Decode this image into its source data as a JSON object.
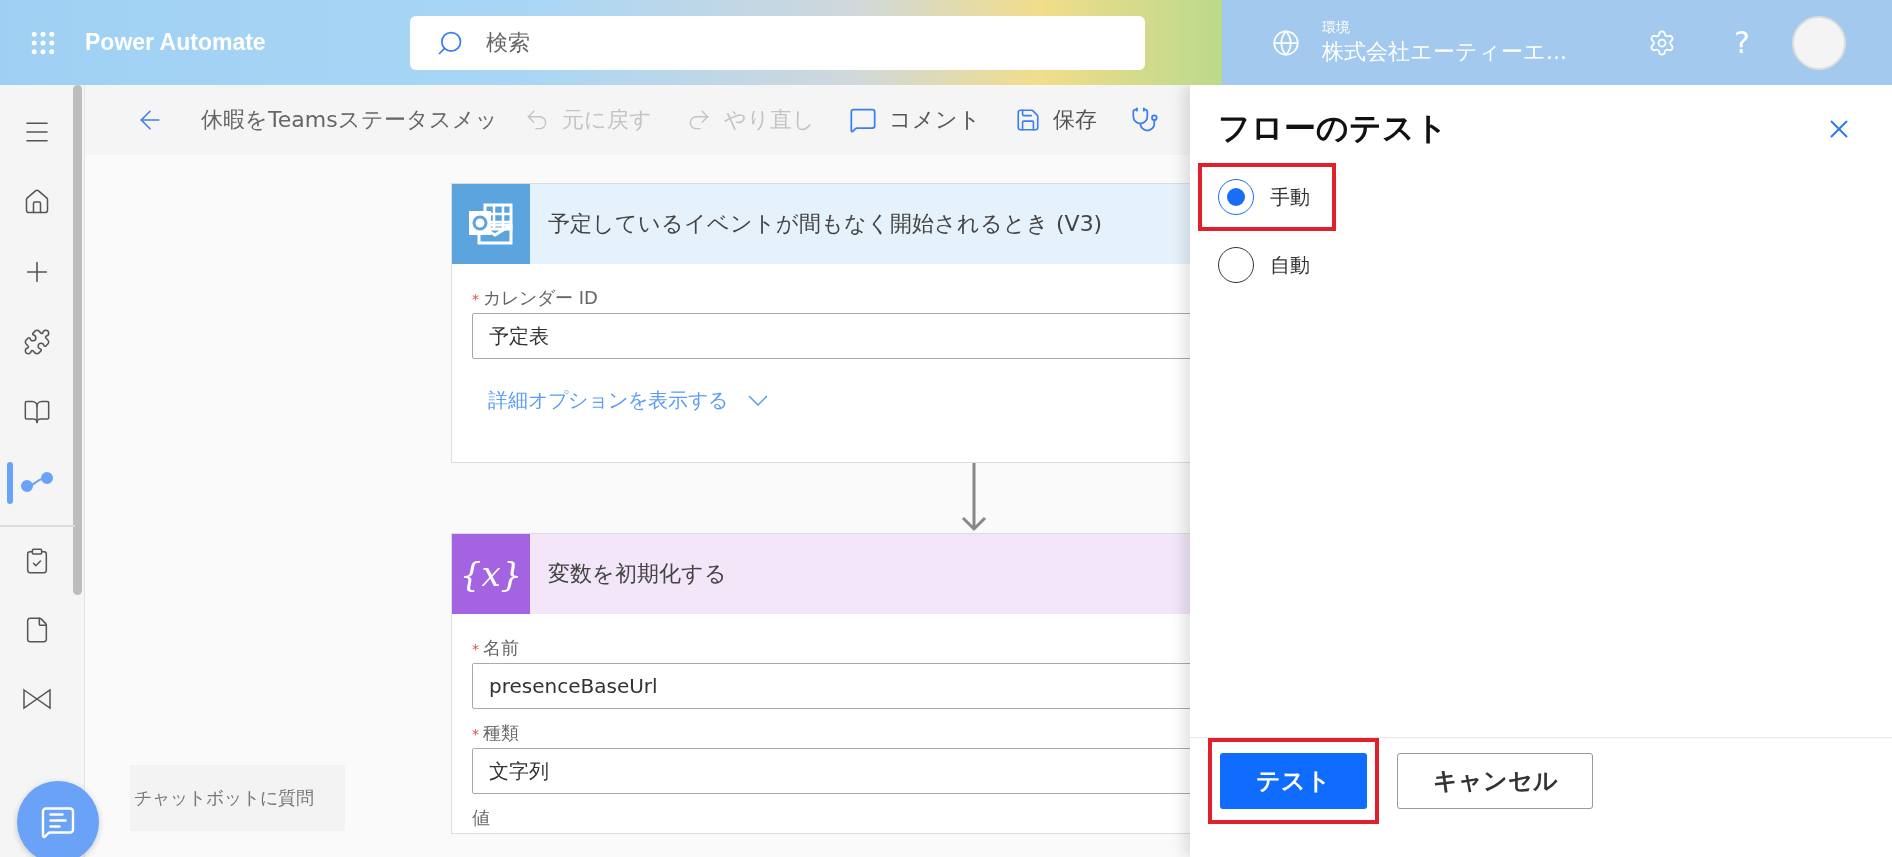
{
  "header": {
    "app_name": "Power Automate",
    "search": {
      "placeholder": "検索"
    },
    "environment": {
      "label": "環境",
      "name": "株式会社エーティーエ..."
    },
    "help": "?"
  },
  "sidebar": {
    "items": [
      {
        "kind": "menu",
        "selected": false
      },
      {
        "kind": "home",
        "selected": false
      },
      {
        "kind": "create",
        "selected": false
      },
      {
        "kind": "templates",
        "selected": false
      },
      {
        "kind": "learn",
        "selected": false
      },
      {
        "kind": "flows",
        "selected": true
      },
      {
        "kind": "approvals",
        "selected": false
      },
      {
        "kind": "documents",
        "selected": false
      },
      {
        "kind": "process",
        "selected": false
      }
    ]
  },
  "toolbar": {
    "flow_name": "休暇をTeamsステータスメッ",
    "actions": [
      {
        "kind": "undo",
        "label": "元に戻す",
        "disabled": true
      },
      {
        "kind": "redo",
        "label": "やり直し",
        "disabled": true
      },
      {
        "kind": "comment",
        "label": "コメント",
        "disabled": false
      },
      {
        "kind": "save",
        "label": "保存",
        "disabled": false
      },
      {
        "kind": "checker"
      }
    ]
  },
  "cards": [
    {
      "kind": "trigger",
      "title": "予定しているイベントが間もなく開始されるとき (V3)",
      "fields": [
        {
          "label": "カレンダー ID",
          "required_mark": "*",
          "value": "予定表"
        }
      ],
      "link": "詳細オプションを表示する"
    },
    {
      "kind": "variable",
      "icon_text": "{x}",
      "title": "変数を初期化する",
      "fields": [
        {
          "label": "名前",
          "required_mark": "*",
          "value": "presenceBaseUrl"
        },
        {
          "label": "種類",
          "required_mark": "*",
          "value": "文字列"
        },
        {
          "label": "値"
        }
      ]
    }
  ],
  "chat": {
    "label": "チャットボットに質問"
  },
  "panel": {
    "title": "フローのテスト",
    "options": [
      {
        "label": "手動",
        "selected": true,
        "highlighted": true
      },
      {
        "label": "自動",
        "selected": false,
        "highlighted": false
      }
    ],
    "buttons": [
      {
        "label": "テスト",
        "kind": "primary",
        "highlighted": true
      },
      {
        "label": "キャンセル",
        "kind": "secondary",
        "highlighted": false
      }
    ]
  }
}
